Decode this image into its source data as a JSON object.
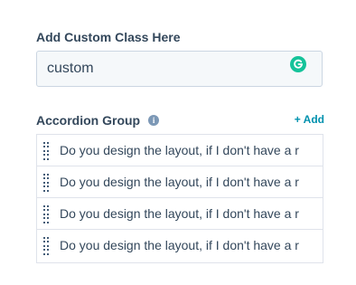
{
  "custom_class": {
    "label": "Add Custom Class Here",
    "value": "custom"
  },
  "grammarly_icon": "grammarly-g",
  "accordion": {
    "label": "Accordion Group",
    "info_icon": "i",
    "add_label": "+ Add",
    "items": [
      "Do you design the layout, if I don't have a r",
      "Do you design the layout, if I don't have a r",
      "Do you design the layout, if I don't have a r",
      "Do you design the layout, if I don't have a r"
    ]
  },
  "colors": {
    "accent": "#0091ae",
    "text": "#33475b",
    "grammarly": "#15c39a"
  }
}
